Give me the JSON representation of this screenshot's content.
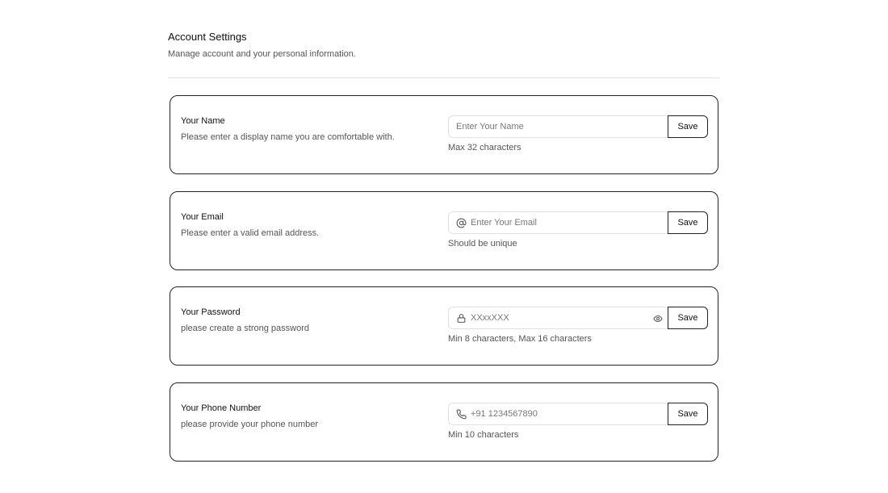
{
  "header": {
    "title": "Account Settings",
    "subtitle": "Manage account and your personal information."
  },
  "cards": [
    {
      "label": "Your Name",
      "description": "Please enter a display name you are comfortable with.",
      "placeholder": "Enter Your Name",
      "value": "",
      "button": "Save",
      "hint": "Max 32 characters"
    },
    {
      "label": "Your Email",
      "description": "Please enter a valid email address.",
      "icon": "at-sign-icon",
      "placeholder": "Enter Your Email",
      "value": "",
      "button": "Save",
      "hint": "Should be unique"
    },
    {
      "label": "Your Password",
      "description": "please create a strong password",
      "icon": "lock-icon",
      "trailing_icon": "eye-icon",
      "placeholder": "XXxxXXX",
      "value": "",
      "button": "Save",
      "hint": "Min 8 characters, Max 16 characters"
    },
    {
      "label": "Your Phone Number",
      "description": "please provide your phone number",
      "icon": "phone-icon",
      "placeholder": "+91 1234567890",
      "value": "",
      "button": "Save",
      "hint": "Min 10 characters"
    }
  ],
  "colors": {
    "border": "#222222",
    "input_border": "#e1e1e1",
    "muted_text": "#555555",
    "divider": "#e2e2e2"
  }
}
